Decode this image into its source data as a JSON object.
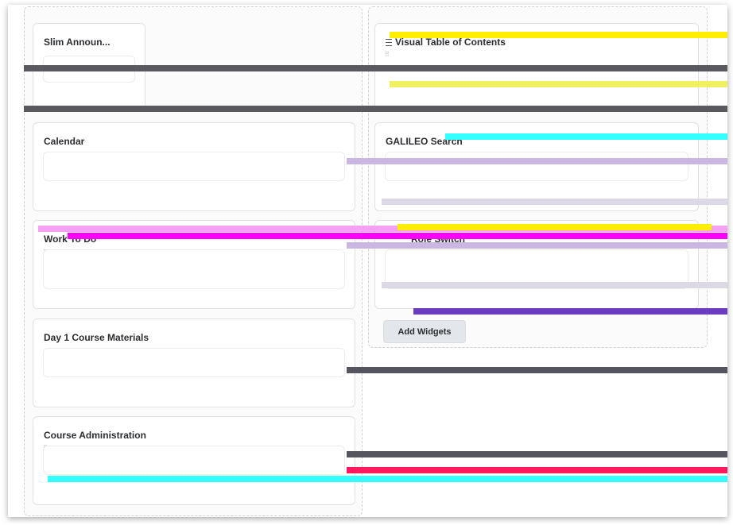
{
  "left_column": {
    "widgets": [
      {
        "title": "Slim Announ...",
        "grip": "⠿"
      },
      {
        "title": "Calendar",
        "grip": "⠿"
      },
      {
        "title": "Work To Do",
        "grip": "⠿"
      },
      {
        "title": "Day 1 Course Materials",
        "grip": "⠿"
      },
      {
        "title": "Course Administration",
        "grip": "⠿"
      }
    ]
  },
  "right_column": {
    "widgets": [
      {
        "title": "Visual Table of Contents",
        "grip": "⠿"
      },
      {
        "title": "GALILEO Search",
        "grip": "⠿"
      },
      {
        "title": "Role Switch",
        "grip": "⠿"
      }
    ],
    "add_widgets_label": "Add Widgets"
  },
  "colors": {
    "glitch_magenta": "#ff00ff",
    "glitch_yellow": "#ffee00",
    "glitch_cyan": "#33ffff",
    "glitch_gray": "#555560",
    "glitch_lavender": "#c9b7e2",
    "glitch_red": "#ff1a5e"
  }
}
